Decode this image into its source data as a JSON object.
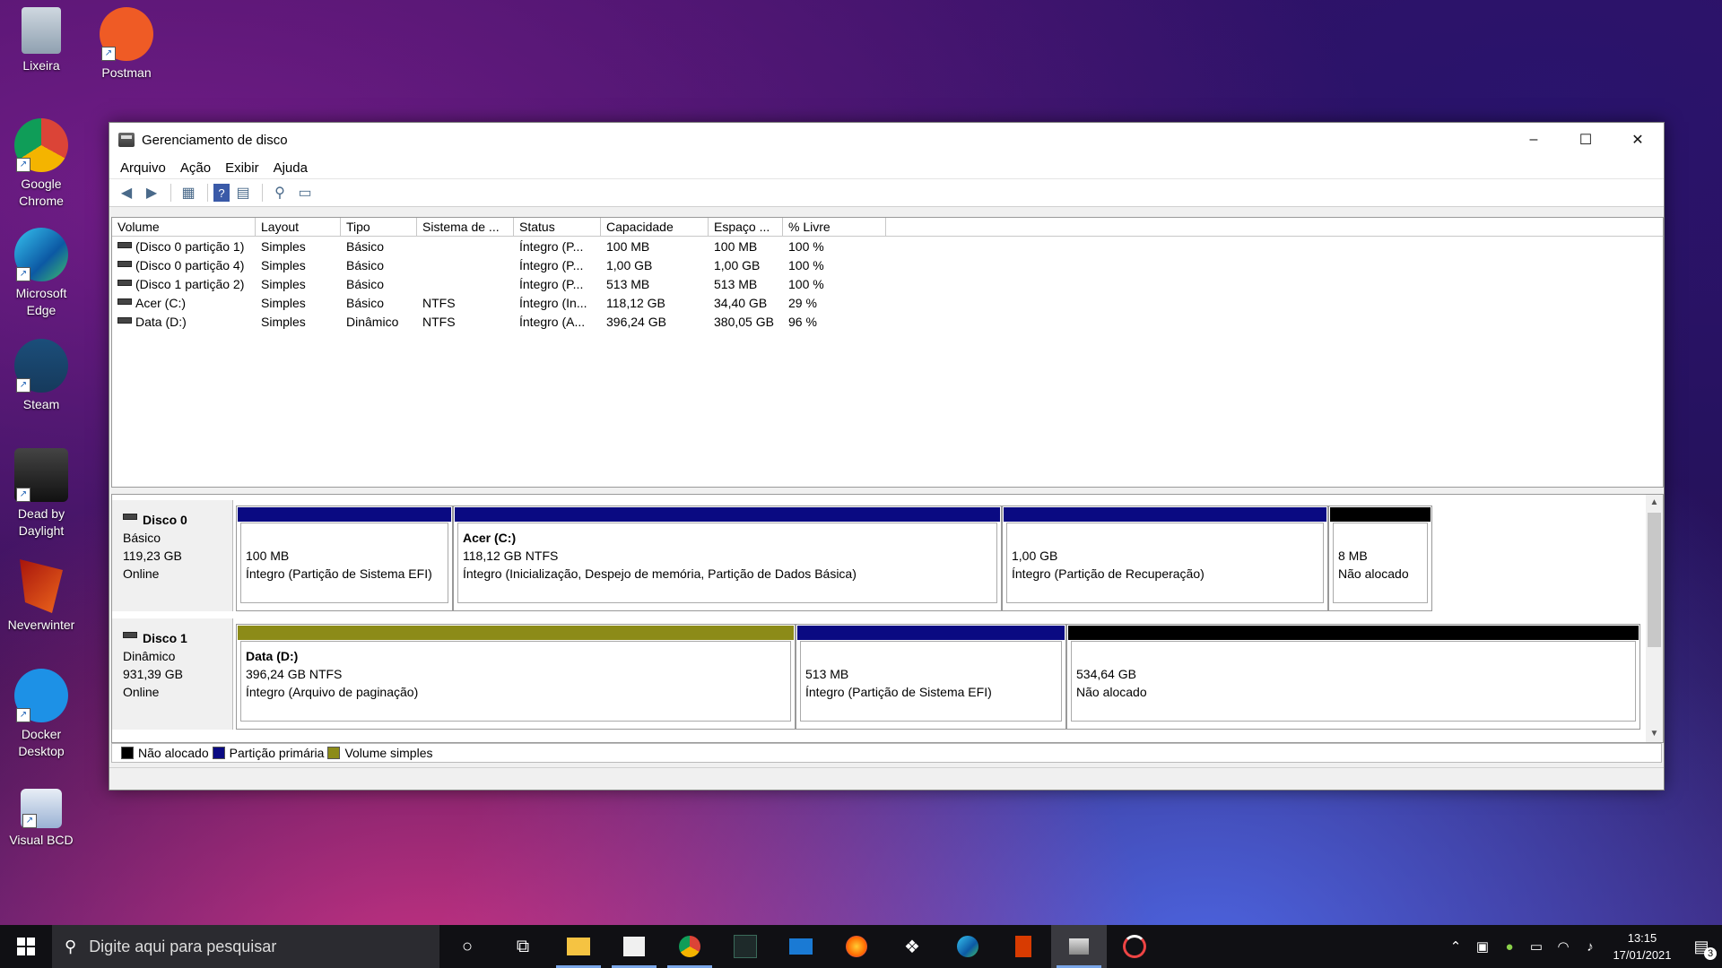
{
  "desktop": {
    "icons": [
      {
        "label": "Lixeira",
        "icon": "recycle-bin-icon"
      },
      {
        "label": "Postman",
        "icon": "postman-icon"
      },
      {
        "label": "Google Chrome",
        "icon": "chrome-icon"
      },
      {
        "label": "Microsoft Edge",
        "icon": "edge-icon"
      },
      {
        "label": "Steam",
        "icon": "steam-icon"
      },
      {
        "label": "Dead by Daylight",
        "icon": "dead-by-daylight-icon"
      },
      {
        "label": "Neverwinter",
        "icon": "neverwinter-icon"
      },
      {
        "label": "Docker Desktop",
        "icon": "docker-icon"
      },
      {
        "label": "Visual BCD",
        "icon": "visual-bcd-icon"
      }
    ]
  },
  "window": {
    "title": "Gerenciamento de disco",
    "controls": {
      "minimize": "–",
      "maximize": "☐",
      "close": "✕"
    },
    "menu": [
      "Arquivo",
      "Ação",
      "Exibir",
      "Ajuda"
    ],
    "list": {
      "headers": [
        "Volume",
        "Layout",
        "Tipo",
        "Sistema de ...",
        "Status",
        "Capacidade",
        "Espaço ...",
        "% Livre"
      ],
      "rows": [
        [
          "(Disco 0 partição 1)",
          "Simples",
          "Básico",
          "",
          "Íntegro (P...",
          "100 MB",
          "100 MB",
          "100 %"
        ],
        [
          "(Disco 0 partição 4)",
          "Simples",
          "Básico",
          "",
          "Íntegro (P...",
          "1,00 GB",
          "1,00 GB",
          "100 %"
        ],
        [
          "(Disco 1 partição 2)",
          "Simples",
          "Básico",
          "",
          "Íntegro (P...",
          "513 MB",
          "513 MB",
          "100 %"
        ],
        [
          "Acer (C:)",
          "Simples",
          "Básico",
          "NTFS",
          "Íntegro (In...",
          "118,12 GB",
          "34,40 GB",
          "29 %"
        ],
        [
          "Data (D:)",
          "Simples",
          "Dinâmico",
          "NTFS",
          "Íntegro (A...",
          "396,24 GB",
          "380,05 GB",
          "96 %"
        ]
      ]
    },
    "disks": [
      {
        "name": "Disco 0",
        "type": "Básico",
        "size": "119,23 GB",
        "state": "Online",
        "partitions": [
          {
            "name": "",
            "size": "100 MB",
            "status": "Íntegro (Partição de Sistema EFI)",
            "color": "#0a0a82"
          },
          {
            "name": "Acer  (C:)",
            "size": "118,12 GB NTFS",
            "status": "Íntegro (Inicialização, Despejo de memória, Partição de Dados Básica)",
            "color": "#0a0a82"
          },
          {
            "name": "",
            "size": "1,00 GB",
            "status": "Íntegro (Partição de Recuperação)",
            "color": "#0a0a82"
          },
          {
            "name": "",
            "size": "8 MB",
            "status": "Não alocado",
            "color": "#000000"
          }
        ]
      },
      {
        "name": "Disco 1",
        "type": "Dinâmico",
        "size": "931,39 GB",
        "state": "Online",
        "partitions": [
          {
            "name": "Data  (D:)",
            "size": "396,24 GB NTFS",
            "status": "Íntegro (Arquivo de paginação)",
            "color": "#8c8b18"
          },
          {
            "name": "",
            "size": "513 MB",
            "status": "Íntegro (Partição de Sistema EFI)",
            "color": "#0a0a82"
          },
          {
            "name": "",
            "size": "534,64 GB",
            "status": "Não alocado",
            "color": "#000000"
          }
        ]
      }
    ],
    "legend": [
      {
        "label": "Não alocado",
        "color": "#000000"
      },
      {
        "label": "Partição primária",
        "color": "#0a0a82"
      },
      {
        "label": "Volume simples",
        "color": "#8c8b18"
      }
    ]
  },
  "taskbar": {
    "search_placeholder": "Digite aqui para pesquisar",
    "apps": [
      "cortana-icon",
      "task-view-icon",
      "file-explorer-icon",
      "store-icon",
      "chrome-icon",
      "predator-icon",
      "mail-icon",
      "firefox-icon",
      "dropbox-icon",
      "edge-icon",
      "office-icon",
      "disk-management-icon",
      "loading-icon"
    ],
    "time": "13:15",
    "date": "17/01/2021",
    "notification_count": "3"
  }
}
